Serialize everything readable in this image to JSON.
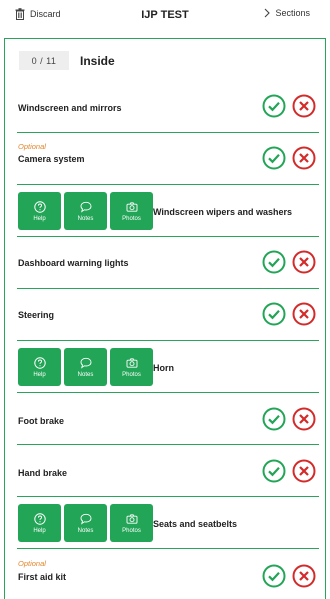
{
  "header": {
    "discard_label": "Discard",
    "title": "IJP TEST",
    "sections_label": "Sections",
    "discard_icon": "trash-icon",
    "sections_icon": "chevron-right-icon"
  },
  "section": {
    "counter": "0 / 11",
    "title": "Inside"
  },
  "colors": {
    "accent": "#22a557",
    "pass": "#22a557",
    "fail": "#d42a2a",
    "optional": "#e2862e"
  },
  "tools": {
    "help": "Help",
    "notes": "Notes",
    "photos": "Photos"
  },
  "items": [
    {
      "label": "Windscreen and mirrors",
      "optional": ""
    },
    {
      "label": "Camera system",
      "optional": "Optional"
    },
    {
      "label": "Windscreen wipers and washers",
      "optional": ""
    },
    {
      "label": "Dashboard warning lights",
      "optional": ""
    },
    {
      "label": "Steering",
      "optional": ""
    },
    {
      "label": "Horn",
      "optional": ""
    },
    {
      "label": "Foot brake",
      "optional": ""
    },
    {
      "label": "Hand brake",
      "optional": ""
    },
    {
      "label": "Seats and seatbelts",
      "optional": ""
    },
    {
      "label": "First aid kit",
      "optional": "Optional"
    }
  ]
}
